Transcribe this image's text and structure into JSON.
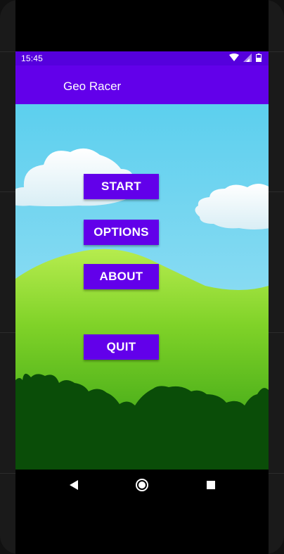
{
  "status_bar": {
    "time": "15:45",
    "icons": [
      "wifi-icon",
      "cell-signal-icon",
      "battery-icon"
    ],
    "color": "#5500dd"
  },
  "app_bar": {
    "title": "Geo Racer",
    "color": "#6200ea"
  },
  "menu": {
    "buttons": [
      {
        "label": "START"
      },
      {
        "label": "OPTIONS"
      },
      {
        "label": "ABOUT"
      },
      {
        "label": "QUIT"
      }
    ],
    "button_color": "#6200ea"
  },
  "scene": {
    "sky_color": "#5ccfee",
    "hill_color": "#66c21e",
    "bush_color": "#0a4d08"
  },
  "nav_bar": {
    "icons": [
      "back-icon",
      "home-icon",
      "recent-apps-icon"
    ]
  }
}
